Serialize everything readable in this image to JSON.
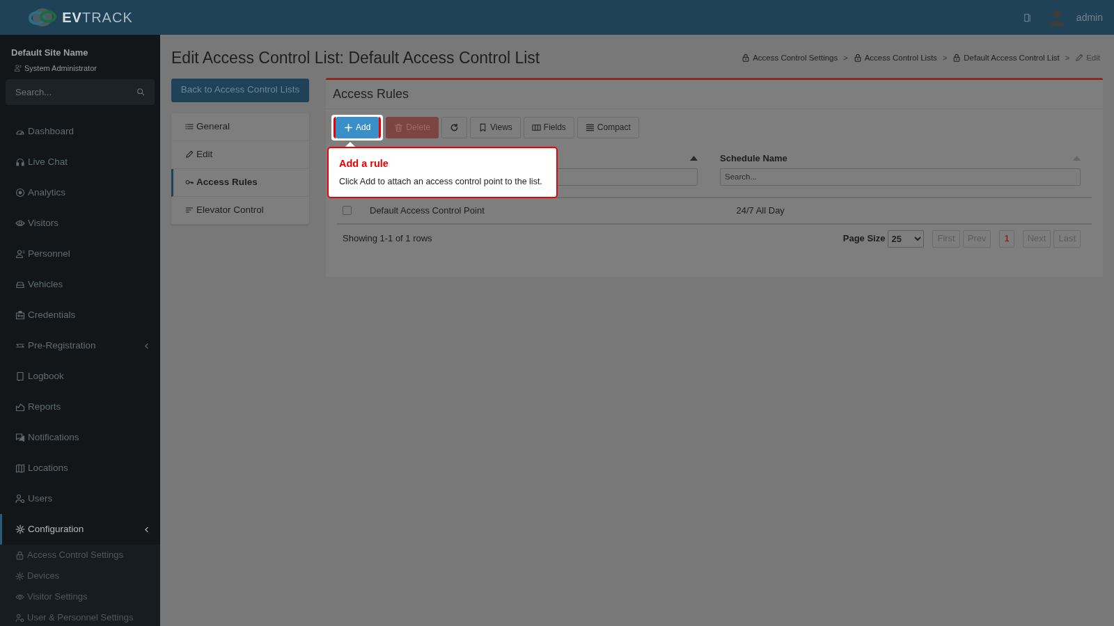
{
  "header": {
    "logo_bold": "EV",
    "logo_light": "TRACK",
    "user": "admin"
  },
  "sidebar": {
    "site_name": "Default Site Name",
    "role": "System Administrator",
    "search": {
      "placeholder": "Search..."
    },
    "items": [
      {
        "label": "Dashboard",
        "selected": false,
        "expandable": false
      },
      {
        "label": "Live Chat",
        "selected": false,
        "expandable": false
      },
      {
        "label": "Analytics",
        "selected": false,
        "expandable": false
      },
      {
        "label": "Visitors",
        "selected": false,
        "expandable": false
      },
      {
        "label": "Personnel",
        "selected": false,
        "expandable": false
      },
      {
        "label": "Vehicles",
        "selected": false,
        "expandable": false
      },
      {
        "label": "Credentials",
        "selected": false,
        "expandable": false
      },
      {
        "label": "Pre-Registration",
        "selected": false,
        "expandable": true
      },
      {
        "label": "Logbook",
        "selected": false,
        "expandable": false
      },
      {
        "label": "Reports",
        "selected": false,
        "expandable": false
      },
      {
        "label": "Notifications",
        "selected": false,
        "expandable": false
      },
      {
        "label": "Locations",
        "selected": false,
        "expandable": false
      },
      {
        "label": "Users",
        "selected": false,
        "expandable": false
      },
      {
        "label": "Configuration",
        "selected": true,
        "expandable": true,
        "children": [
          {
            "label": "Access Control Settings"
          },
          {
            "label": "Devices"
          },
          {
            "label": "Visitor Settings"
          },
          {
            "label": "User & Personnel Settings"
          }
        ]
      }
    ]
  },
  "page": {
    "title": "Edit Access Control List: Default Access Control List",
    "breadcrumbs": [
      {
        "label": "Access Control Settings",
        "separator": ">"
      },
      {
        "label": "Access Control Lists",
        "separator": ">"
      },
      {
        "label": "Default Access Control List",
        "separator": ">"
      },
      {
        "label": "Edit"
      }
    ],
    "back_button": "Back to Access Control Lists",
    "tabs": [
      {
        "label": "General",
        "selected": false
      },
      {
        "label": "Edit",
        "selected": false
      },
      {
        "label": "Access Rules",
        "selected": true
      },
      {
        "label": "Elevator Control",
        "selected": false
      }
    ]
  },
  "card": {
    "title": "Access Rules",
    "toolbar": [
      {
        "label": "Add",
        "kind": "primary"
      },
      {
        "label": "Delete",
        "kind": "danger",
        "disabled": true
      },
      {
        "kind": "default"
      },
      {
        "label": "Views",
        "kind": "default"
      },
      {
        "label": "Fields",
        "kind": "default"
      },
      {
        "label": "Compact",
        "kind": "default"
      }
    ],
    "columns": [
      {
        "sorted": true
      },
      {
        "heading": "Schedule Name",
        "search_placeholder": "Search...",
        "sorted": false
      }
    ],
    "rows": [
      {
        "checked": false,
        "cells": [
          "Default Access Control Point",
          "24/7 All Day"
        ]
      }
    ],
    "summary": "Showing 1-1 of 1 rows",
    "page_size_label": "Page Size",
    "page_size": "25",
    "pager": [
      {
        "label": "First",
        "disabled": true,
        "selected": false
      },
      {
        "label": "Prev",
        "disabled": true,
        "selected": false
      },
      {
        "label": "1",
        "disabled": false,
        "selected": true
      },
      {
        "label": "Next",
        "disabled": true,
        "selected": false
      },
      {
        "label": "Last",
        "disabled": true,
        "selected": false
      }
    ]
  },
  "tour": {
    "title": "Add a rule",
    "text": "Click Add to attach an access control point to the list."
  }
}
